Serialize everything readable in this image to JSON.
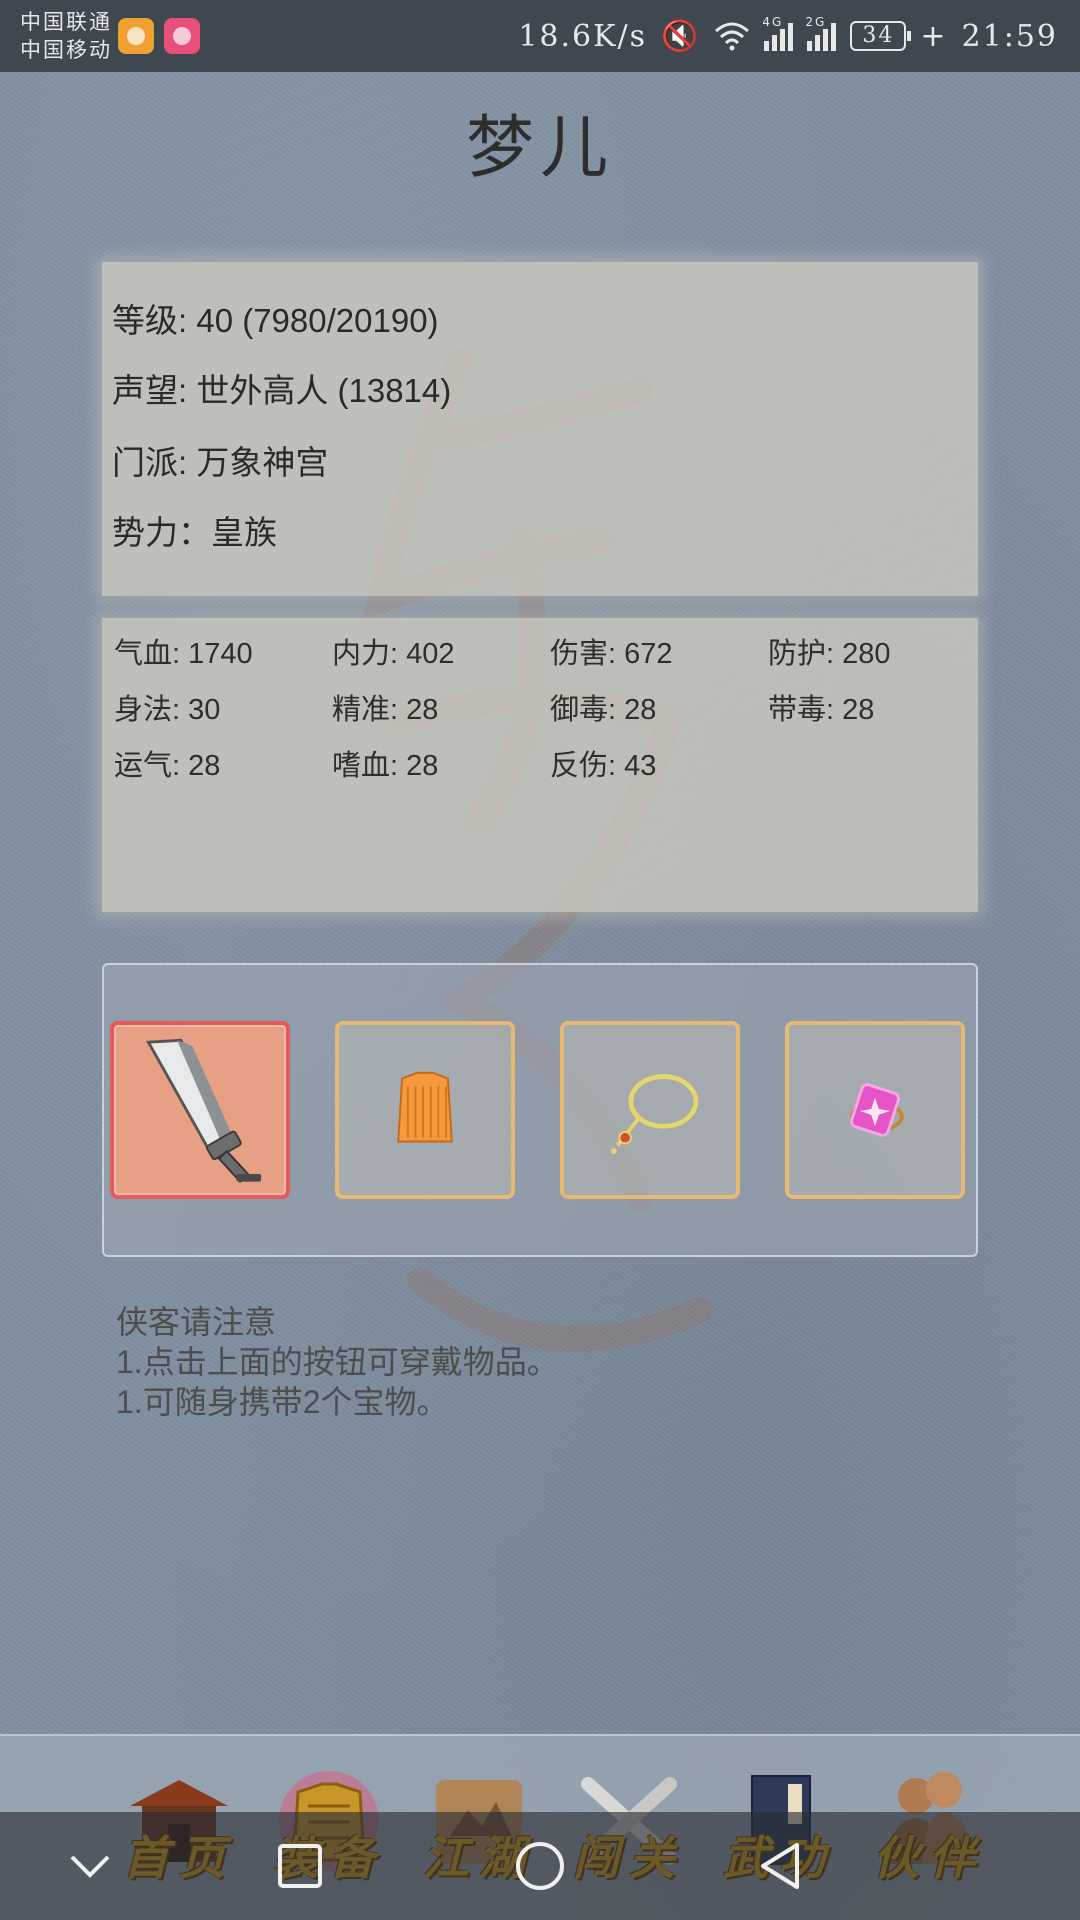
{
  "status_bar": {
    "carrier_1": "中国联通",
    "carrier_2": "中国移动",
    "net_speed": "18.6K/s",
    "signal_1_label": "4G",
    "signal_2_label": "2G",
    "battery": "34",
    "time": "21:59"
  },
  "title": "梦儿",
  "info": {
    "level": "等级: 40 (7980/20190)",
    "reputation": "声望: 世外高人 (13814)",
    "sect": "门派: 万象神宫",
    "faction": "势力：皇族"
  },
  "stats": [
    "气血: 1740",
    "内力: 402",
    "伤害: 672",
    "防护: 280",
    "身法: 30",
    "精准: 28",
    "御毒: 28",
    "带毒: 28",
    "运气: 28",
    "嗜血: 28",
    "反伤: 43"
  ],
  "equipment": [
    {
      "item": "sword-icon",
      "selected": true
    },
    {
      "item": "armor-icon",
      "selected": false
    },
    {
      "item": "necklace-icon",
      "selected": false
    },
    {
      "item": "gem-ring-icon",
      "selected": false
    }
  ],
  "tips": {
    "heading": "侠客请注意",
    "line_1": "1.点击上面的按钮可穿戴物品。",
    "line_2": "1.可随身携带2个宝物。"
  },
  "nav": {
    "home": "首页",
    "equip": "装备",
    "jianghu": "江湖",
    "stage": "闯关",
    "martial": "武功",
    "partner": "伙伴"
  },
  "colors": {
    "accent_gold": "#d9a21a",
    "slot_border": "#e8b870",
    "selected_slot": "#e7a083"
  }
}
